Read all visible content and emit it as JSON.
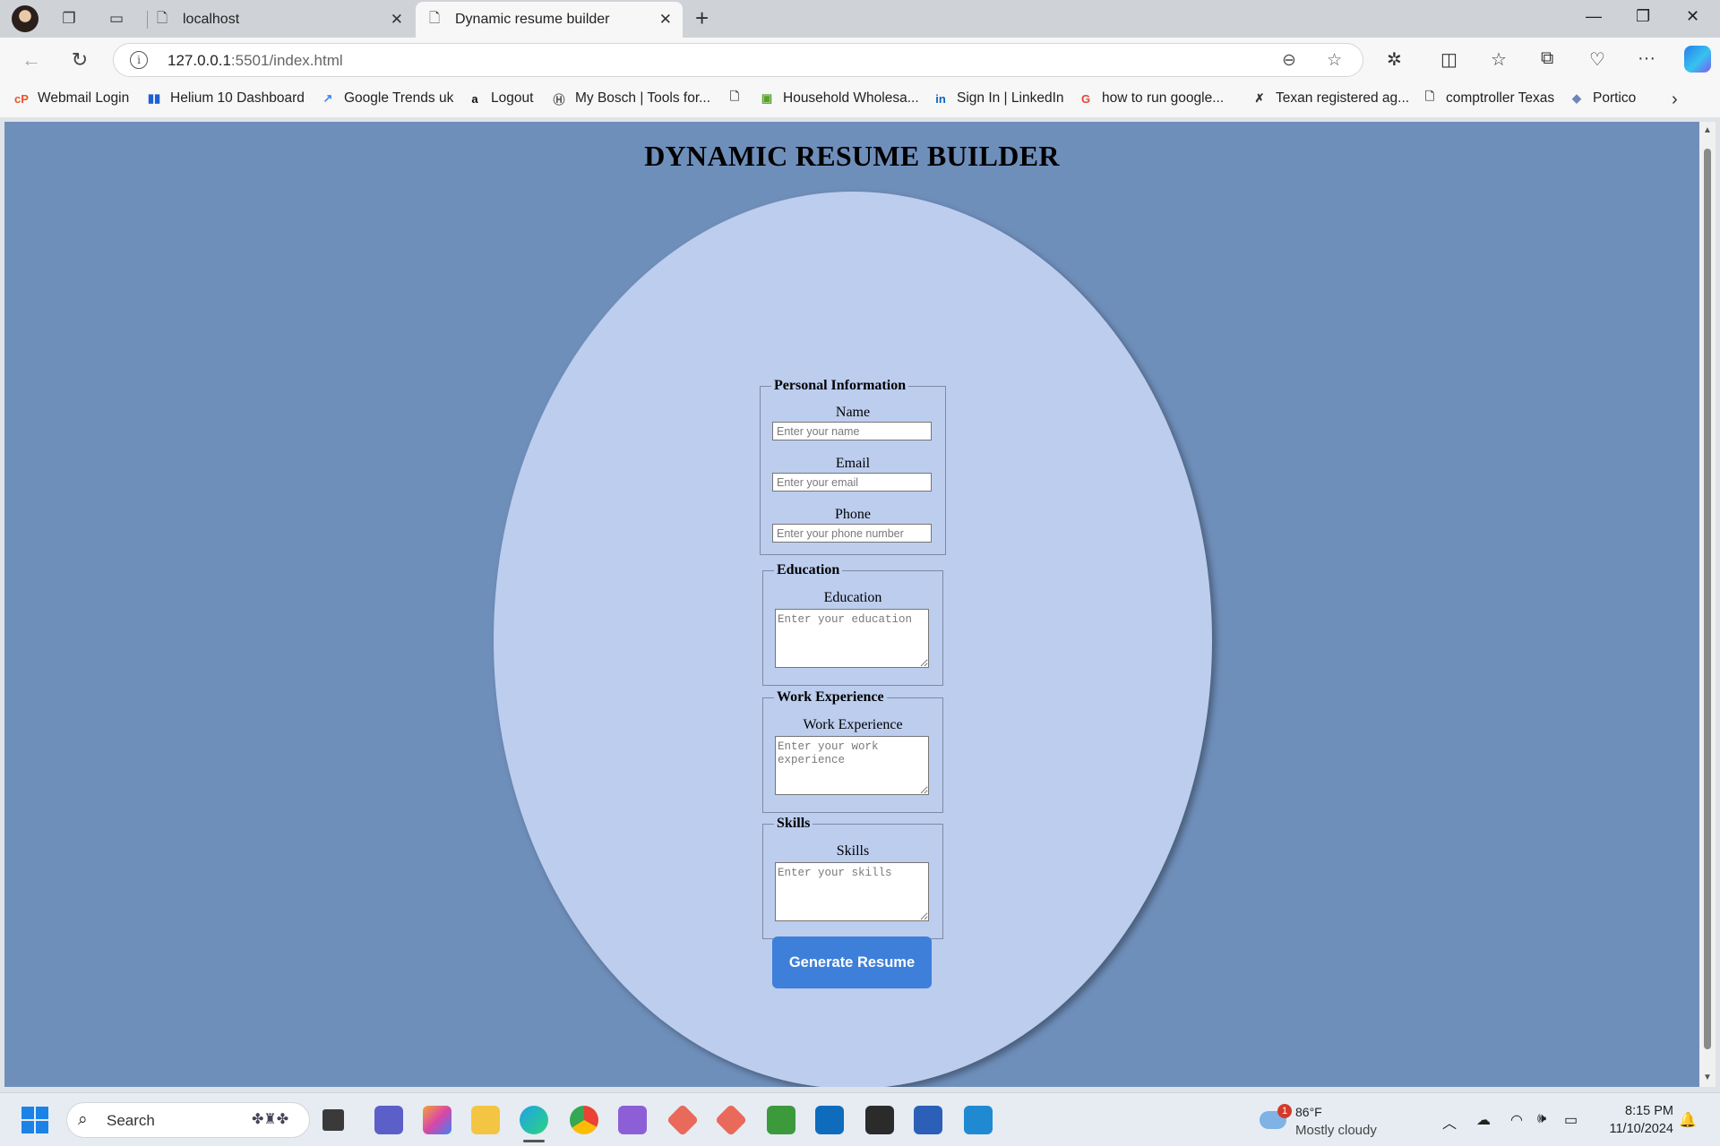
{
  "browser": {
    "tabs": [
      {
        "label": "localhost",
        "active": false
      },
      {
        "label": "Dynamic resume builder",
        "active": true
      }
    ],
    "address": {
      "host": "127.0.0.1",
      "path": ":5501/index.html"
    },
    "bookmarks": [
      {
        "label": "Webmail Login",
        "icon": "cpanel-icon",
        "color": "#e8542c"
      },
      {
        "label": "Helium 10 Dashboard",
        "icon": "helium10-icon",
        "color": "#1e5fd6"
      },
      {
        "label": "Google Trends uk",
        "icon": "trends-icon",
        "color": "#4285f4"
      },
      {
        "label": "Logout",
        "icon": "amazon-icon",
        "color": "#111111"
      },
      {
        "label": "My Bosch | Tools for...",
        "icon": "bosch-icon",
        "color": "#555555"
      },
      {
        "label": "",
        "icon": "page-icon",
        "color": "#555555"
      },
      {
        "label": "Household Wholesa...",
        "icon": "household-icon",
        "color": "#5aa02c"
      },
      {
        "label": "Sign In | LinkedIn",
        "icon": "linkedin-icon",
        "color": "#0a66c2"
      },
      {
        "label": "how to run google...",
        "icon": "google-icon",
        "color": "#ea4335"
      },
      {
        "label": "Texan registered ag...",
        "icon": "texan-icon",
        "color": "#333333"
      },
      {
        "label": "comptroller Texas",
        "icon": "page-icon",
        "color": "#555555"
      },
      {
        "label": "Portico",
        "icon": "portico-icon",
        "color": "#6c86b6"
      }
    ]
  },
  "page": {
    "title": "DYNAMIC RESUME BUILDER",
    "personal": {
      "legend": "Personal Information",
      "name_label": "Name",
      "name_placeholder": "Enter your name",
      "email_label": "Email",
      "email_placeholder": "Enter your email",
      "phone_label": "Phone",
      "phone_placeholder": "Enter your phone number"
    },
    "education": {
      "legend": "Education",
      "label": "Education",
      "placeholder": "Enter your education"
    },
    "work": {
      "legend": "Work Experience",
      "label": "Work Experience",
      "placeholder": "Enter your work experience"
    },
    "skills": {
      "legend": "Skills",
      "label": "Skills",
      "placeholder": "Enter your skills"
    },
    "submit_label": "Generate Resume",
    "colors": {
      "background": "#6f8fbb",
      "ellipse": "#bccdee",
      "button": "#3d7fd9"
    }
  },
  "taskbar": {
    "search_label": "Search",
    "weather": {
      "temp": "86°F",
      "condition": "Mostly cloudy",
      "badge": "1"
    },
    "clock": {
      "time": "8:15 PM",
      "date": "11/10/2024"
    }
  }
}
